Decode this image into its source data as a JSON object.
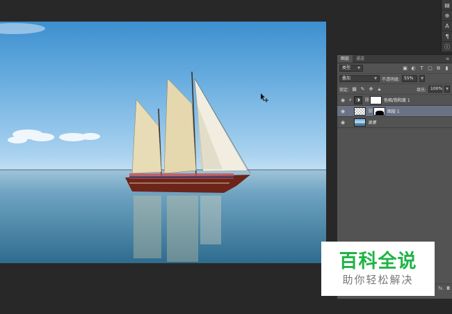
{
  "layers_panel": {
    "tabs": [
      {
        "label": "图层",
        "active": true
      },
      {
        "label": "通道",
        "active": false
      }
    ],
    "filter": {
      "kind_label": "类型",
      "icons": [
        "image-filter-icon",
        "adjustment-filter-icon",
        "type-filter-icon",
        "shape-filter-icon",
        "smart-object-filter-icon"
      ]
    },
    "blend_mode": "叠加",
    "opacity_label": "不透明度:",
    "opacity_value": "55%",
    "lock_label": "锁定:",
    "fill_label": "填充:",
    "fill_value": "100%",
    "layers": [
      {
        "name": "色相/饱和度 1",
        "type": "adjustment",
        "visible": true,
        "selected": false
      },
      {
        "name": "图层 1",
        "type": "pixel",
        "visible": true,
        "selected": true
      },
      {
        "name": "背景",
        "type": "background",
        "visible": true,
        "selected": false
      }
    ],
    "bottom_icons": [
      "fx",
      "mask"
    ]
  },
  "watermark": {
    "title": "百科全说",
    "subtitle": "助你轻松解决"
  },
  "colors": {
    "panel_bg": "#535353",
    "app_bg": "#282828",
    "selected_layer": "#6a7285",
    "watermark_green": "#1fb445"
  }
}
